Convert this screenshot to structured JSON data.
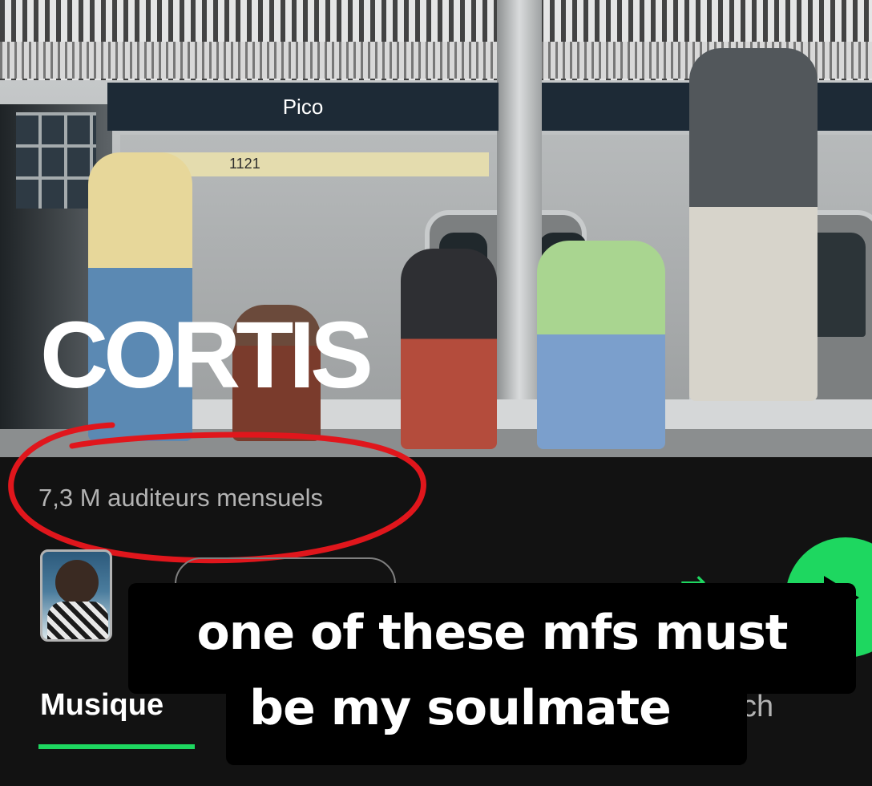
{
  "hero": {
    "artist_name": "CORTIS",
    "station_sign": "Pico",
    "train_number": "1121"
  },
  "stats": {
    "monthly_listeners": "7,3 M auditeurs mensuels"
  },
  "tabs": {
    "active": "Musique",
    "partial": "ch"
  },
  "colors": {
    "accent": "#1ed760",
    "background": "#121212",
    "annotation": "#e0161c"
  },
  "caption": {
    "line1": "one of these mfs must",
    "line2": "be my soulmate"
  },
  "icons": {
    "shuffle": "shuffle-icon",
    "play": "play-icon"
  }
}
